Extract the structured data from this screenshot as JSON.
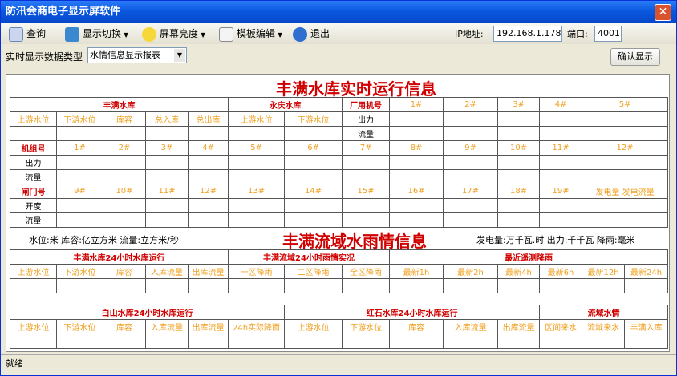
{
  "window": {
    "title": "防汛会商电子显示屏软件",
    "close": "✕"
  },
  "toolbar": {
    "query": "查询",
    "switch": "显示切换",
    "brightness": "屏幕亮度",
    "template": "模板编辑",
    "exit": "退出",
    "ip_label": "IP地址:",
    "ip_value": "192.168.1.178",
    "port_label": "端口:",
    "port_value": "4001"
  },
  "filter": {
    "label": "实时显示数据类型",
    "value": "水情信息显示报表",
    "confirm": "确认显示"
  },
  "board": {
    "title1": "丰满水库实时运行信息",
    "title2": "丰满流域水雨情信息",
    "units_left": "水位:米 库容:亿立方米 流量:立方米/秒",
    "units_right": "发电量:万千瓦.时 出力:千千瓦 降雨:毫米",
    "t1_row1": [
      "丰满水库",
      "永庆水库",
      "厂用机号",
      "1#",
      "2#",
      "3#",
      "4#",
      "5#"
    ],
    "t1_row2": [
      "上游水位",
      "下游水位",
      "库容",
      "总入库",
      "总出库",
      "上游水位",
      "下游水位",
      "出力"
    ],
    "t1_flow": "流量",
    "t1_units": [
      "机组号",
      "1#",
      "2#",
      "3#",
      "4#",
      "5#",
      "6#",
      "7#",
      "8#",
      "9#",
      "10#",
      "11#",
      "12#"
    ],
    "t1_gates": [
      "闸门号",
      "9#",
      "10#",
      "11#",
      "12#",
      "13#",
      "14#",
      "15#",
      "16#",
      "17#",
      "18#",
      "19#",
      "发电量",
      "发电流量"
    ],
    "t1_out": "出力",
    "t1_open": "开度",
    "t2_head": [
      "丰满水库24小时水库运行",
      "丰满流域24小时雨情实况",
      "最近遥测降雨"
    ],
    "t2_cols": [
      "上游水位",
      "下游水位",
      "库容",
      "入库流量",
      "出库流量",
      "一区降雨",
      "二区降雨",
      "全区降雨",
      "最新1h",
      "最新2h",
      "最新4h",
      "最新6h",
      "最新12h",
      "最新24h"
    ],
    "t3_head": [
      "白山水库24小时水库运行",
      "红石水库24小时水库运行",
      "流域水情"
    ],
    "t3_cols": [
      "上游水位",
      "下游水位",
      "库容",
      "入库流量",
      "出库流量",
      "24h实际降雨",
      "上游水位",
      "下游水位",
      "库容",
      "入库流量",
      "出库流量",
      "区间来水",
      "流域来水",
      "丰满入库"
    ]
  },
  "status": {
    "text": "就绪"
  }
}
